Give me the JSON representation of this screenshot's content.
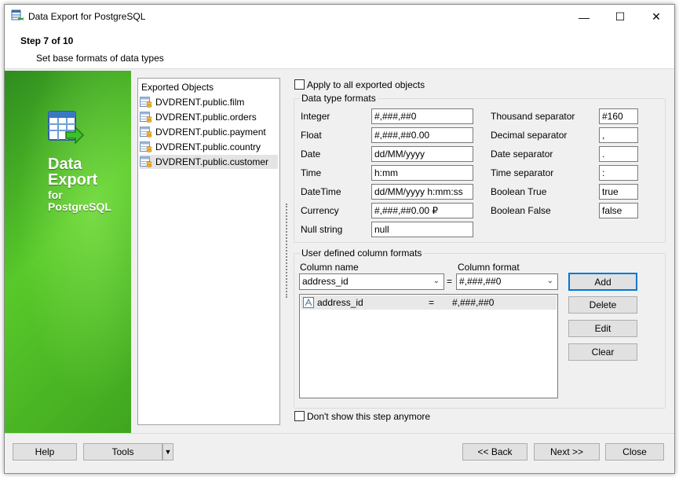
{
  "window": {
    "title": "Data Export for PostgreSQL",
    "minimize_glyph": "—",
    "maximize_glyph": "☐",
    "close_glyph": "✕"
  },
  "header": {
    "step": "Step 7 of 10",
    "subtitle": "Set base formats of data types"
  },
  "banner": {
    "line1": "Data",
    "line2": "Export",
    "line3": "for",
    "line4": "PostgreSQL",
    "icon": "table-export-icon",
    "colors": {
      "dark": "#2e8c1f",
      "light": "#58c92a"
    }
  },
  "tree": {
    "header": "Exported Objects",
    "items": [
      {
        "label": "DVDRENT.public.film",
        "selected": false
      },
      {
        "label": "DVDRENT.public.orders",
        "selected": false
      },
      {
        "label": "DVDRENT.public.payment",
        "selected": false
      },
      {
        "label": "DVDRENT.public.country",
        "selected": false
      },
      {
        "label": "DVDRENT.public.customer",
        "selected": true
      }
    ]
  },
  "apply_all": {
    "label": "Apply to all exported objects",
    "checked": false
  },
  "formats": {
    "group_title": "Data type formats",
    "left": [
      {
        "label": "Integer",
        "value": "#,###,##0"
      },
      {
        "label": "Float",
        "value": "#,###,##0.00"
      },
      {
        "label": "Date",
        "value": "dd/MM/yyyy"
      },
      {
        "label": "Time",
        "value": "h:mm"
      },
      {
        "label": "DateTime",
        "value": "dd/MM/yyyy h:mm:ss"
      },
      {
        "label": "Currency",
        "value": "#,###,##0.00 ₽"
      },
      {
        "label": "Null string",
        "value": "null"
      }
    ],
    "right": [
      {
        "label": "Thousand separator",
        "value": "#160"
      },
      {
        "label": "Decimal separator",
        "value": ","
      },
      {
        "label": "Date separator",
        "value": "."
      },
      {
        "label": "Time separator",
        "value": ":"
      },
      {
        "label": "Boolean True",
        "value": "true"
      },
      {
        "label": "Boolean False",
        "value": "false"
      }
    ]
  },
  "user_formats": {
    "group_title": "User defined column formats",
    "column_name_label": "Column name",
    "column_format_label": "Column format",
    "column_name_value": "address_id",
    "equals": "=",
    "column_format_value": "#,###,##0",
    "rows": [
      {
        "name": "address_id",
        "eq": "=",
        "format": "#,###,##0"
      }
    ],
    "buttons": {
      "add": "Add",
      "delete": "Delete",
      "edit": "Edit",
      "clear": "Clear"
    }
  },
  "dont_show": {
    "label": "Don't show this step anymore",
    "checked": false
  },
  "footer": {
    "help": "Help",
    "tools": "Tools",
    "back": "<< Back",
    "next": "Next >>",
    "close": "Close"
  },
  "colors": {
    "focus": "#0078d7",
    "panel": "#f0f0f0"
  }
}
